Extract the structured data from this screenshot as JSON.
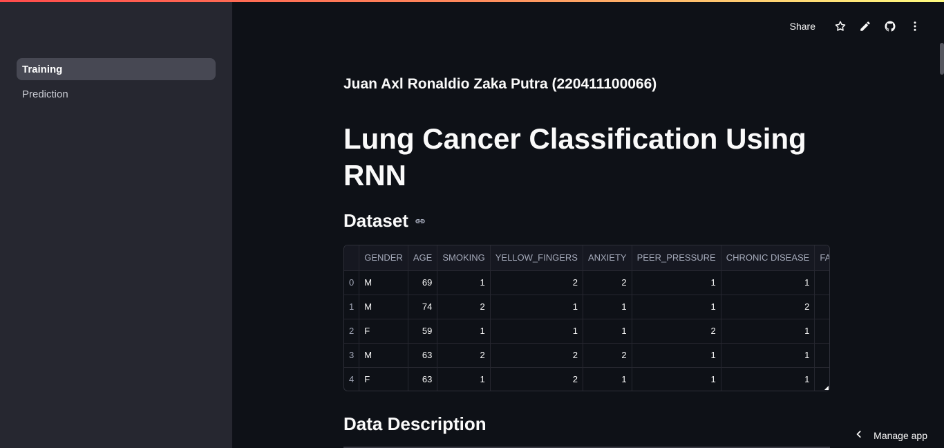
{
  "sidebar": {
    "items": [
      {
        "label": "Training",
        "active": true
      },
      {
        "label": "Prediction",
        "active": false
      }
    ]
  },
  "header": {
    "share_label": "Share",
    "icons": [
      "star-icon",
      "pencil-icon",
      "github-icon",
      "more-vert-icon"
    ]
  },
  "main": {
    "author": "Juan Axl Ronaldio Zaka Putra (220411100066)",
    "title": "Lung Cancer Classification Using RNN",
    "dataset_heading": "Dataset",
    "description_heading": "Data Description"
  },
  "table": {
    "columns": [
      "",
      "GENDER",
      "AGE",
      "SMOKING",
      "YELLOW_FINGERS",
      "ANXIETY",
      "PEER_PRESSURE",
      "CHRONIC DISEASE",
      "FAT"
    ],
    "rows": [
      [
        "0",
        "M",
        "69",
        "1",
        "2",
        "2",
        "1",
        "1"
      ],
      [
        "1",
        "M",
        "74",
        "2",
        "1",
        "1",
        "1",
        "2"
      ],
      [
        "2",
        "F",
        "59",
        "1",
        "1",
        "1",
        "2",
        "1"
      ],
      [
        "3",
        "M",
        "63",
        "2",
        "2",
        "2",
        "1",
        "1"
      ],
      [
        "4",
        "F",
        "63",
        "1",
        "2",
        "1",
        "1",
        "1"
      ]
    ]
  },
  "footer": {
    "manage_app": "Manage app"
  },
  "colors": {
    "background": "#0e1117",
    "sidebar": "#262730",
    "accent": "#ff4b4b"
  }
}
